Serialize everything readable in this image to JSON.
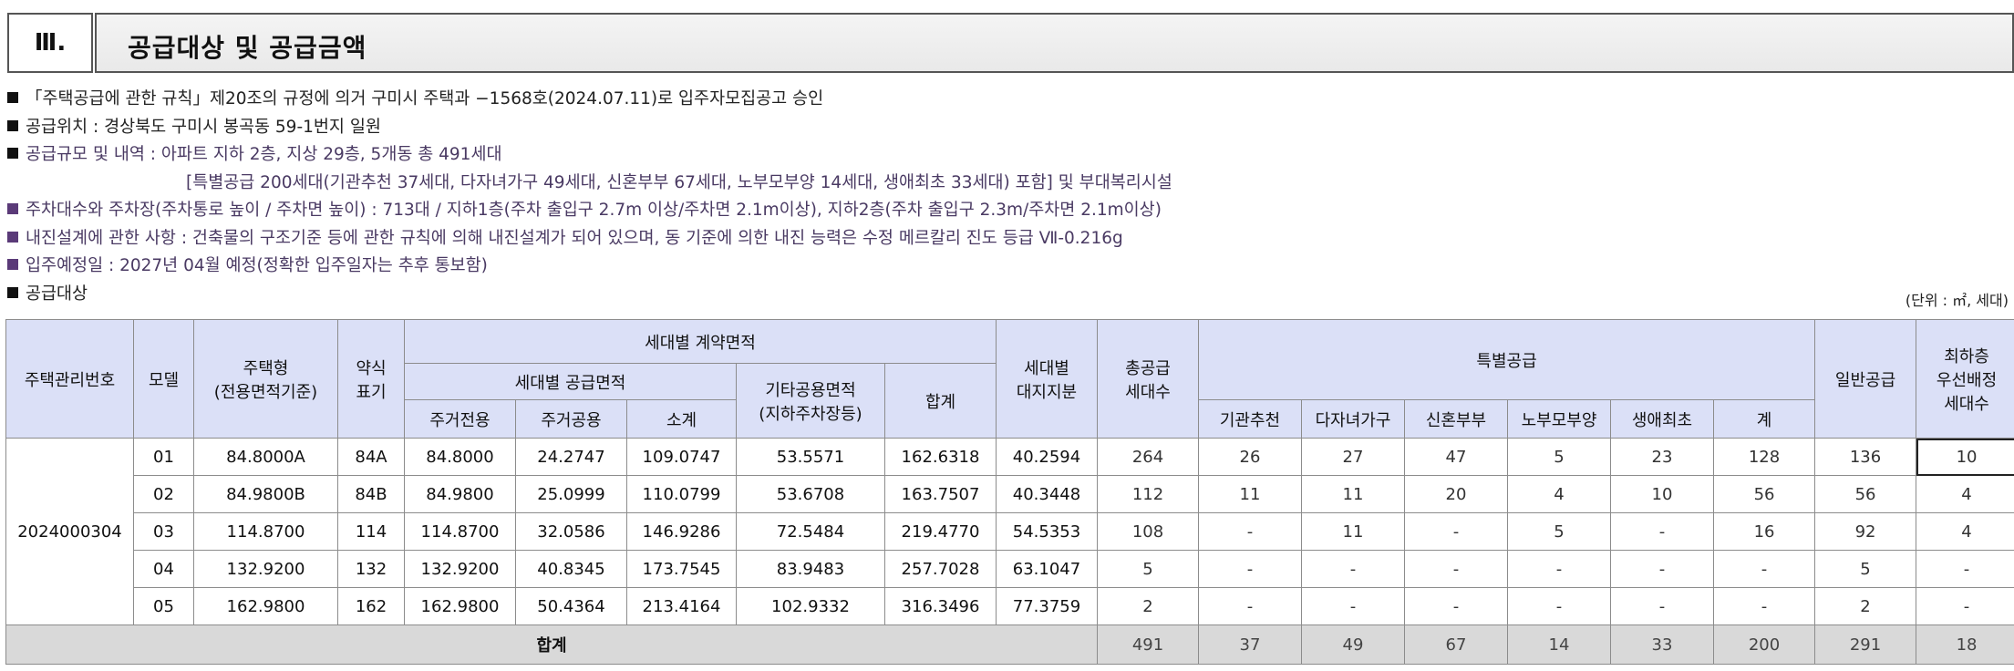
{
  "section": {
    "number": "Ⅲ.",
    "title": "공급대상 및 공급금액"
  },
  "bullets": [
    "「주택공급에 관한 규칙」제20조의 규정에 의거 구미시 주택과 −1568호(2024.07.11)로 입주자모집공고 승인",
    "공급위치 : 경상북도 구미시 봉곡동 59-1번지 일원",
    "공급규모 및 내역 : 아파트 지하 2층, 지상 29층, 5개동 총 491세대",
    "[특별공급 200세대(기관추천 37세대, 다자녀가구 49세대, 신혼부부 67세대, 노부모부양 14세대, 생애최초 33세대) 포함] 및 부대복리시설",
    "주차대수와 주차장(주차통로 높이 / 주차면 높이) : 713대 / 지하1층(주차 출입구 2.7m 이상/주차면 2.1m이상), 지하2층(주차 출입구 2.3m/주차면 2.1m이상)",
    "내진설계에 관한 사항 : 건축물의 구조기준 등에 관한 규칙에 의해 내진설계가 되어 있으며, 동 기준에 의한 내진 능력은 수정 메르칼리 진도 등급 Ⅶ-0.216g",
    "입주예정일 : 2027년 04월 예정(정확한 입주일자는 추후 통보함)",
    "공급대상"
  ],
  "unit_note": "(단위 : ㎡, 세대)",
  "table": {
    "headers": {
      "mgmt_no": "주택관리번호",
      "model": "모델",
      "type_line1": "주택형",
      "type_line2": "(전용면적기준)",
      "abbr_line1": "약식",
      "abbr_line2": "표기",
      "contract_area": "세대별 계약면적",
      "supply_area": "세대별 공급면적",
      "exclusive": "주거전용",
      "common": "주거공용",
      "subtotal": "소계",
      "other_line1": "기타공용면적",
      "other_line2": "(지하주차장등)",
      "sum": "합계",
      "land_line1": "세대별",
      "land_line2": "대지지분",
      "total_line1": "총공급",
      "total_line2": "세대수",
      "special": "특별공급",
      "institution": "기관추천",
      "multichild": "다자녀가구",
      "newlywed": "신혼부부",
      "elderly": "노부모부양",
      "firsttime": "생애최초",
      "special_sum": "계",
      "general": "일반공급",
      "lowfloor_line1": "최하층",
      "lowfloor_line2": "우선배정",
      "lowfloor_line3": "세대수"
    },
    "mgmt_no": "2024000304",
    "rows": [
      {
        "model": "01",
        "type": "84.8000A",
        "abbr": "84A",
        "exclusive": "84.8000",
        "common": "24.2747",
        "subtotal": "109.0747",
        "other": "53.5571",
        "sum": "162.6318",
        "land": "40.2594",
        "total": "264",
        "institution": "26",
        "multichild": "27",
        "newlywed": "47",
        "elderly": "5",
        "firsttime": "23",
        "special_sum": "128",
        "general": "136",
        "lowfloor": "10"
      },
      {
        "model": "02",
        "type": "84.9800B",
        "abbr": "84B",
        "exclusive": "84.9800",
        "common": "25.0999",
        "subtotal": "110.0799",
        "other": "53.6708",
        "sum": "163.7507",
        "land": "40.3448",
        "total": "112",
        "institution": "11",
        "multichild": "11",
        "newlywed": "20",
        "elderly": "4",
        "firsttime": "10",
        "special_sum": "56",
        "general": "56",
        "lowfloor": "4"
      },
      {
        "model": "03",
        "type": "114.8700",
        "abbr": "114",
        "exclusive": "114.8700",
        "common": "32.0586",
        "subtotal": "146.9286",
        "other": "72.5484",
        "sum": "219.4770",
        "land": "54.5353",
        "total": "108",
        "institution": "-",
        "multichild": "11",
        "newlywed": "-",
        "elderly": "5",
        "firsttime": "-",
        "special_sum": "16",
        "general": "92",
        "lowfloor": "4"
      },
      {
        "model": "04",
        "type": "132.9200",
        "abbr": "132",
        "exclusive": "132.9200",
        "common": "40.8345",
        "subtotal": "173.7545",
        "other": "83.9483",
        "sum": "257.7028",
        "land": "63.1047",
        "total": "5",
        "institution": "-",
        "multichild": "-",
        "newlywed": "-",
        "elderly": "-",
        "firsttime": "-",
        "special_sum": "-",
        "general": "5",
        "lowfloor": "-"
      },
      {
        "model": "05",
        "type": "162.9800",
        "abbr": "162",
        "exclusive": "162.9800",
        "common": "50.4364",
        "subtotal": "213.4164",
        "other": "102.9332",
        "sum": "316.3496",
        "land": "77.3759",
        "total": "2",
        "institution": "-",
        "multichild": "-",
        "newlywed": "-",
        "elderly": "-",
        "firsttime": "-",
        "special_sum": "-",
        "general": "2",
        "lowfloor": "-"
      }
    ],
    "totals": {
      "label": "합계",
      "total": "491",
      "institution": "37",
      "multichild": "49",
      "newlywed": "67",
      "elderly": "14",
      "firsttime": "33",
      "special_sum": "200",
      "general": "291",
      "lowfloor": "18"
    }
  }
}
